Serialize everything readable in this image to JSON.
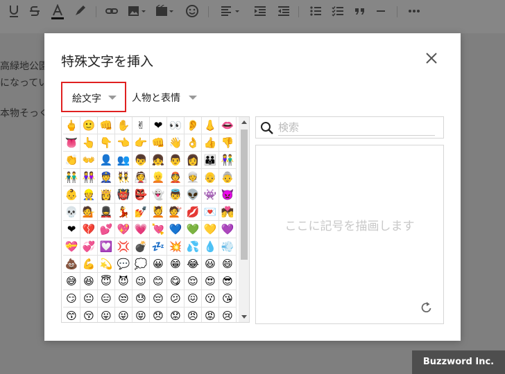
{
  "toolbar": {
    "icons": [
      "underline-icon",
      "strikethrough-icon",
      "text-color-icon",
      "highlight-icon",
      "link-icon",
      "image-icon",
      "media-icon",
      "emoji-icon",
      "align-icon",
      "indent-icon",
      "outdent-icon",
      "bullet-list-icon",
      "checklist-icon",
      "blockquote-icon",
      "horizontal-rule-icon",
      "more-icon"
    ]
  },
  "editor": {
    "lines": [
      "高緑地公園",
      "になってい",
      "本物そっく"
    ]
  },
  "brand": "Buzzword Inc.",
  "dialog": {
    "title": "特殊文字を挿入",
    "category": "絵文字",
    "subcategory": "人物と表情",
    "search_placeholder": "検索",
    "canvas_placeholder": "ここに記号を描画します"
  },
  "emoji_grid": [
    [
      "🖕",
      "🙂",
      "👊",
      "✋",
      "✌",
      "❤",
      "👀",
      "👂",
      "👃",
      "👄"
    ],
    [
      "👅",
      "👆",
      "👇",
      "👈",
      "👉",
      "👊",
      "👋",
      "👌",
      "👍",
      "👎"
    ],
    [
      "👏",
      "👐",
      "👤",
      "👥",
      "👦",
      "👧",
      "👨",
      "👩",
      "👪",
      "👫"
    ],
    [
      "👬",
      "👭",
      "👮",
      "👯",
      "👰",
      "👱",
      "👲",
      "👳",
      "👴",
      "👵"
    ],
    [
      "👶",
      "👷",
      "👸",
      "👹",
      "👺",
      "👻",
      "👼",
      "👽",
      "👾",
      "👿"
    ],
    [
      "💀",
      "💁",
      "💂",
      "💃",
      "💅",
      "💆",
      "💇",
      "💋",
      "💌",
      "💏"
    ],
    [
      "❤",
      "💔",
      "💕",
      "💖",
      "💗",
      "💘",
      "💙",
      "💚",
      "💛",
      "💜"
    ],
    [
      "💝",
      "💞",
      "💟",
      "💢",
      "💣",
      "💤",
      "💥",
      "💦",
      "💧",
      "💨"
    ],
    [
      "💩",
      "💪",
      "💫",
      "💬",
      "💭",
      "😀",
      "😁",
      "😂",
      "😃",
      "😄"
    ],
    [
      "😅",
      "😆",
      "😇",
      "😈",
      "😉",
      "😊",
      "😋",
      "😌",
      "😍",
      "😎"
    ],
    [
      "😏",
      "😐",
      "😑",
      "😒",
      "😓",
      "😔",
      "😕",
      "😖",
      "😗",
      "😘"
    ],
    [
      "😙",
      "😚",
      "😛",
      "😜",
      "😝",
      "😞",
      "😟",
      "😠",
      "😡",
      "😢"
    ]
  ]
}
